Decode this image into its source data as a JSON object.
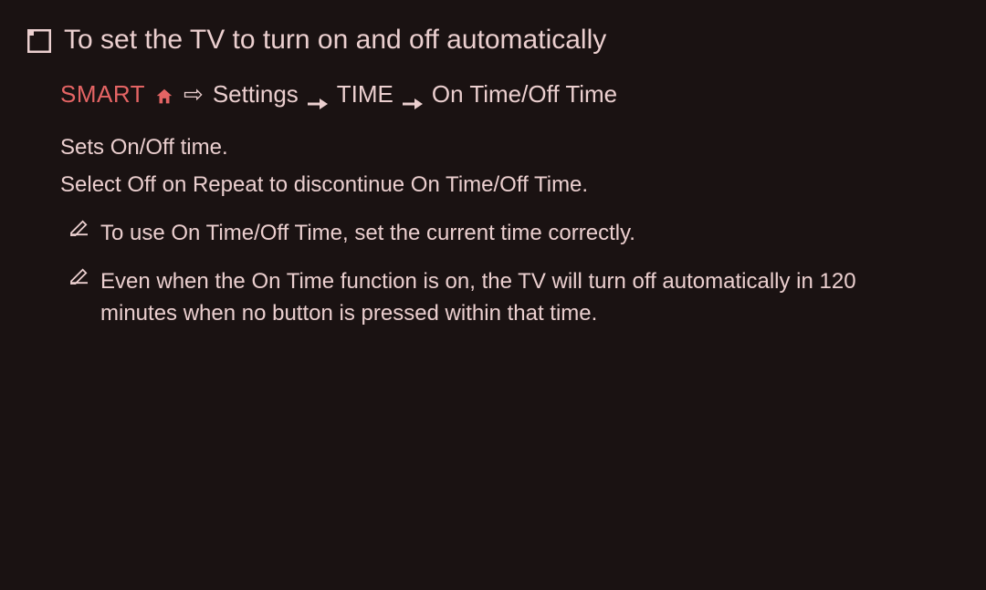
{
  "title": "To set the TV to turn on and off automatically",
  "breadcrumb": {
    "smart": "SMART",
    "settings": "Settings",
    "time": "TIME",
    "on_off": "On Time/Off Time"
  },
  "body": {
    "line1": "Sets On/Off time.",
    "line2": "Select Off on Repeat to discontinue On Time/Off Time."
  },
  "notes": {
    "n1": "To use On Time/Off Time, set the current time correctly.",
    "n2": "Even when the On Time function is on, the TV will turn off automatically in 120 minutes when no button is pressed within that time."
  }
}
